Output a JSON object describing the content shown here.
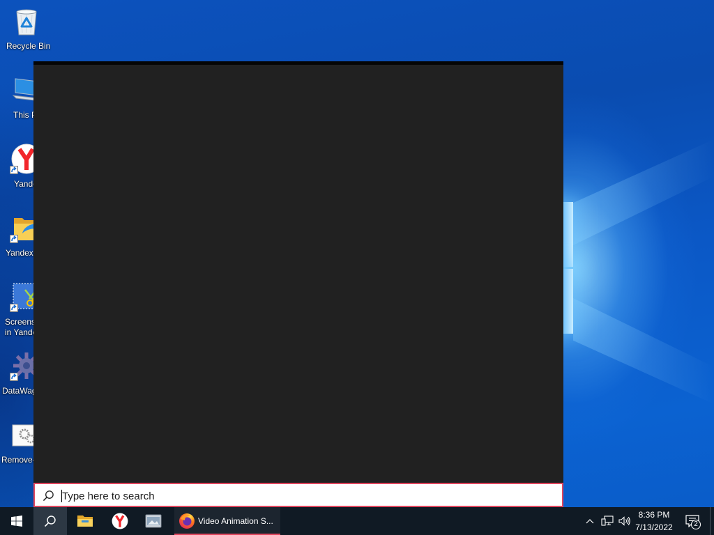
{
  "desktop": {
    "icons": [
      {
        "icon": "recycle-bin-icon",
        "lines": [
          "Recycle Bin"
        ],
        "shortcut": false
      },
      {
        "icon": "this-pc-icon",
        "lines": [
          "This P"
        ],
        "shortcut": false
      },
      {
        "icon": "yandex-browser-icon",
        "lines": [
          "Yande"
        ],
        "shortcut": true
      },
      {
        "icon": "yandex-disk-icon",
        "lines": [
          "Yandex."
        ],
        "shortcut": true
      },
      {
        "icon": "screenshot-tool-icon",
        "lines": [
          "Screens",
          "in Yande"
        ],
        "shortcut": true
      },
      {
        "icon": "datawag-icon",
        "lines": [
          "DataWag"
        ],
        "shortcut": true
      },
      {
        "icon": "remove-tool-icon",
        "lines": [
          "Remove-"
        ],
        "shortcut": false
      }
    ]
  },
  "search": {
    "icon": "search-icon",
    "placeholder": "Type here to search"
  },
  "taskbar": {
    "start": {
      "icon": "windows-logo-icon"
    },
    "search_button": {
      "icon": "search-icon",
      "active": true
    },
    "pinned": [
      {
        "icon": "file-explorer-icon"
      },
      {
        "icon": "yandex-browser-icon"
      },
      {
        "icon": "app-window-icon"
      }
    ],
    "running": [
      {
        "icon": "firefox-icon",
        "label": "Video Animation S...",
        "active": true
      }
    ]
  },
  "tray": {
    "icons": [
      "chevron-up-icon",
      "network-icon",
      "volume-icon"
    ],
    "time": "8:36 PM",
    "date": "7/13/2022",
    "notification_icon": "action-center-icon",
    "notification_count": "2"
  },
  "colors": {
    "accent": "#e0465e",
    "taskbar": "#101a24",
    "panel": "#212121"
  }
}
